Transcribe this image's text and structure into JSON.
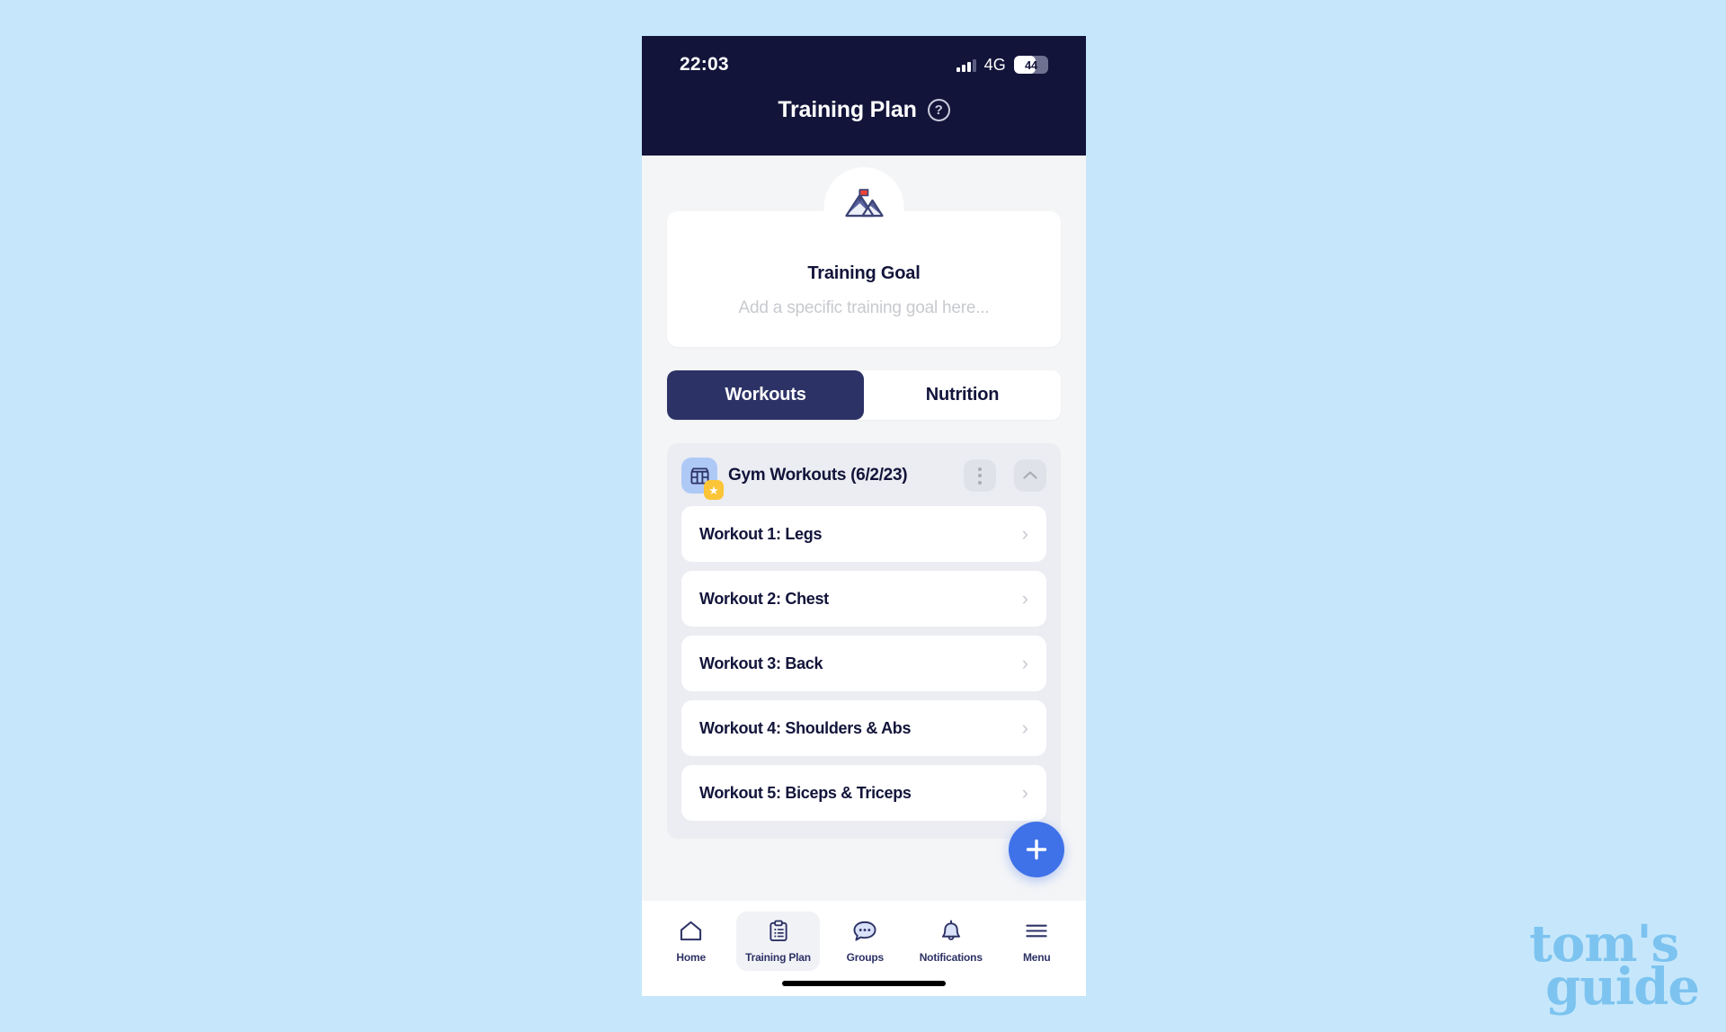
{
  "colors": {
    "page_background": "#c6e7fb",
    "header_navy": "#12143a",
    "accent_blue": "#3f72e8",
    "tab_active": "#2d3266",
    "group_background": "#ebedf2",
    "badge_yellow": "#fcc537",
    "icon_blue": "#afc9f7",
    "watermark_blue": "#7cc3f0"
  },
  "status_bar": {
    "time": "22:03",
    "network": "4G",
    "battery_percent": "44",
    "signal_icon": "signal-bars-icon",
    "battery_icon": "battery-icon"
  },
  "header": {
    "title": "Training Plan",
    "help_label": "?",
    "help_icon": "question-mark-circle-icon"
  },
  "goal_card": {
    "icon": "mountain-flag-icon",
    "title": "Training Goal",
    "placeholder": "Add a specific training goal here..."
  },
  "tabs": [
    {
      "label": "Workouts",
      "active": true
    },
    {
      "label": "Nutrition",
      "active": false
    }
  ],
  "group": {
    "icon": "gym-rack-icon",
    "star_badge_icon": "star-icon",
    "star_glyph": "★",
    "title": "Gym Workouts (6/2/23)",
    "more_icon": "more-vertical-icon",
    "collapse_icon": "chevron-up-icon"
  },
  "workouts": [
    {
      "label": "Workout 1: Legs",
      "chevron": "›"
    },
    {
      "label": "Workout 2: Chest",
      "chevron": "›"
    },
    {
      "label": "Workout 3: Back",
      "chevron": "›"
    },
    {
      "label": "Workout 4: Shoulders & Abs",
      "chevron": "›"
    },
    {
      "label": "Workout 5: Biceps & Triceps",
      "chevron": "›"
    }
  ],
  "fab": {
    "icon": "plus-icon",
    "label": "+"
  },
  "bottom_nav": [
    {
      "label": "Home",
      "icon": "home-icon",
      "active": false
    },
    {
      "label": "Training Plan",
      "icon": "clipboard-icon",
      "active": true
    },
    {
      "label": "Groups",
      "icon": "chat-bubble-icon",
      "active": false
    },
    {
      "label": "Notifications",
      "icon": "bell-icon",
      "active": false
    },
    {
      "label": "Menu",
      "icon": "hamburger-menu-icon",
      "active": false
    }
  ],
  "watermark": {
    "line1": "tom's",
    "line2": "guide"
  }
}
